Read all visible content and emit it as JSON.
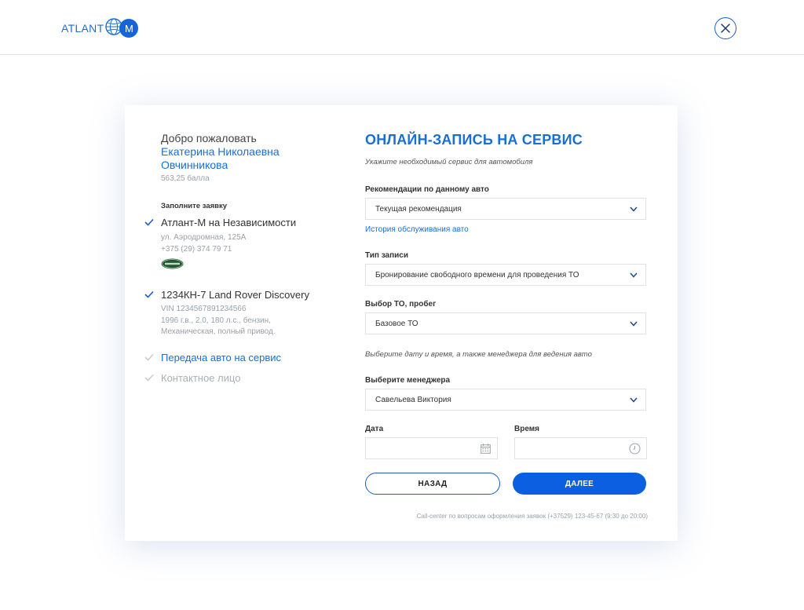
{
  "header": {
    "logo_text": "ATLANT",
    "logo_letter": "M"
  },
  "sidebar": {
    "welcome": "Добро пожаловать",
    "user_name_line1": "Екатерина Николаевна",
    "user_name_line2": "Овчинникова",
    "points": "563,25 балла",
    "fill_label": "Заполните заявку",
    "steps": [
      {
        "title": "Атлант-М на Независимости",
        "lines": [
          "ул. Аэродромная, 125А",
          "+375 (29) 374 79 71"
        ],
        "badge": "LAND ROVER",
        "done": true
      },
      {
        "title": "1234КН-7 Land Rover Discovery",
        "lines": [
          "VIN 1234567891234566",
          "1996 г.в., 2.0, 180 л.с., бензин,",
          "Механическая, полный привод."
        ],
        "done": true
      },
      {
        "title": "Передача авто на сервис",
        "active": true
      },
      {
        "title": "Контактное лицо",
        "pending": true
      }
    ]
  },
  "form": {
    "title": "ОНЛАЙН-ЗАПИСЬ НА СЕРВИС",
    "subtitle": "Укажите необходимый сервис для автомобиля",
    "recommendations": {
      "label": "Рекомендации по данному авто",
      "value": "Текущая рекомендация"
    },
    "history_link": "История обслуживания авто",
    "record_type": {
      "label": "Тип записи",
      "value": "Бронирование свободного времени для проведения ТО"
    },
    "service": {
      "label": "Выбор ТО, пробег",
      "value": "Базовое ТО"
    },
    "hint": "Выберите дату и время, а также менеджера для ведения авто",
    "manager": {
      "label": "Выберите менеджера",
      "value": "Савельева Виктория"
    },
    "date": {
      "label": "Дата",
      "value": ""
    },
    "time": {
      "label": "Время",
      "value": ""
    },
    "back_label": "НАЗАД",
    "next_label": "ДАЛЕЕ",
    "callcenter": "Call-center по вопросам оформления заявок (+37529) 123-45-67 (9:30 до 20:00)"
  },
  "colors": {
    "accent": "#1a6fd6",
    "button_primary": "#0b5fe0",
    "check_done": "#1a5dc8",
    "check_pending": "#c8cdd3",
    "muted_text": "#9aa1aa"
  }
}
